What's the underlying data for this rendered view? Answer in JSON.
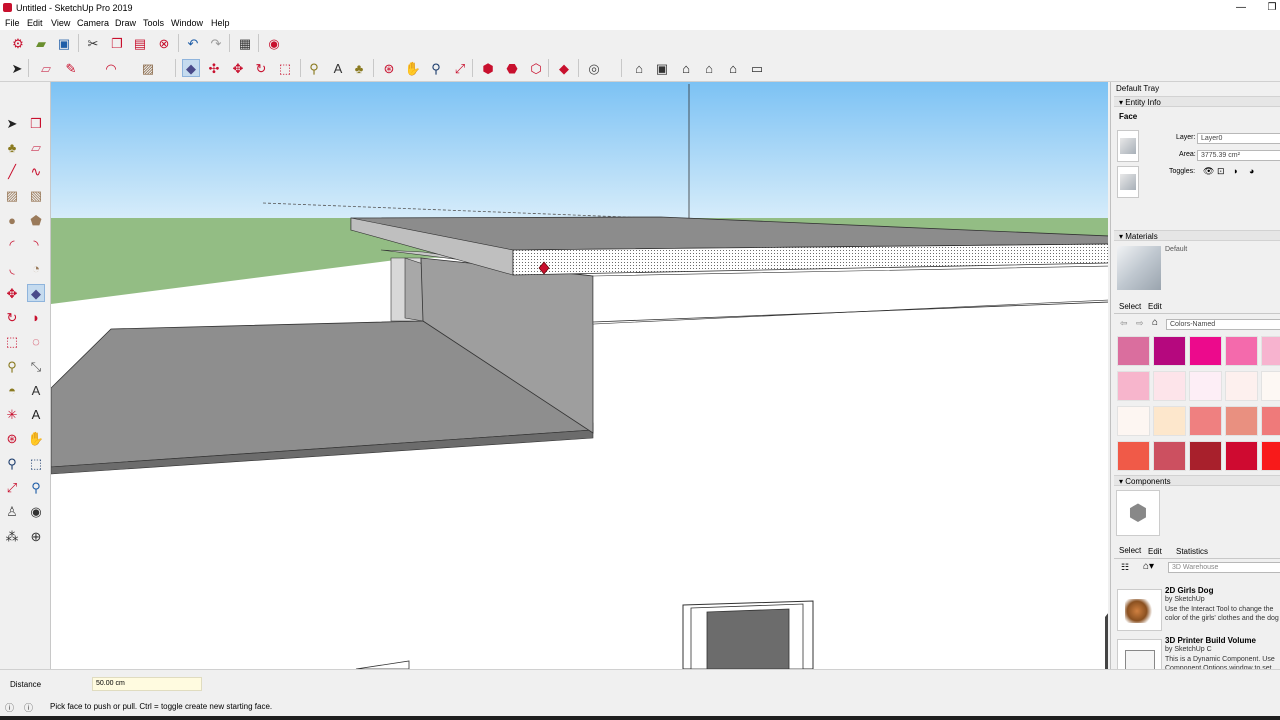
{
  "window": {
    "title": "Untitled - SketchUp Pro 2019",
    "minimize": "—",
    "restore": "❐"
  },
  "menu": [
    "File",
    "Edit",
    "View",
    "Camera",
    "Draw",
    "Tools",
    "Window",
    "Help"
  ],
  "toolbar1": [
    {
      "name": "getting-started-icon",
      "glyph": "⚙",
      "color": "#c8102e"
    },
    {
      "name": "open-icon",
      "glyph": "▰",
      "color": "#6a8f2f"
    },
    {
      "name": "save-icon",
      "glyph": "▣",
      "color": "#1f5ea8"
    },
    {
      "name": "cut-icon",
      "glyph": "✂",
      "color": "#333333"
    },
    {
      "name": "copy-icon",
      "glyph": "❐",
      "color": "#c8102e"
    },
    {
      "name": "paste-icon",
      "glyph": "▤",
      "color": "#c8102e"
    },
    {
      "name": "erase-icon",
      "glyph": "⊗",
      "color": "#c8102e"
    },
    {
      "name": "undo-icon",
      "glyph": "↶",
      "color": "#1f5ea8"
    },
    {
      "name": "redo-icon",
      "glyph": "↷",
      "color": "#9a9a9a"
    },
    {
      "name": "print-icon",
      "glyph": "▦",
      "color": "#333333"
    },
    {
      "name": "model-info-icon",
      "glyph": "◉",
      "color": "#c8102e"
    }
  ],
  "toolbar2": [
    {
      "name": "select-icon",
      "glyph": "➤",
      "color": "#222222"
    },
    {
      "name": "eraser-icon",
      "glyph": "▱",
      "color": "#d0506a"
    },
    {
      "name": "pencil-icon",
      "glyph": "✎",
      "color": "#c8102e"
    },
    {
      "name": "arc-icon",
      "glyph": "◠",
      "color": "#c8102e"
    },
    {
      "name": "rectangle-icon",
      "glyph": "▨",
      "color": "#8a6a4a"
    },
    {
      "name": "push-pull-icon",
      "glyph": "◆",
      "color": "#4a4a8a"
    },
    {
      "name": "move-icon",
      "glyph": "✣",
      "color": "#c8102e"
    },
    {
      "name": "move2-icon",
      "glyph": "✥",
      "color": "#c8102e"
    },
    {
      "name": "rotate-icon",
      "glyph": "↻",
      "color": "#c8102e"
    },
    {
      "name": "scale-icon",
      "glyph": "⬚",
      "color": "#c8102e"
    },
    {
      "name": "tape-measure-icon",
      "glyph": "⚲",
      "color": "#8a7a20"
    },
    {
      "name": "text-icon",
      "glyph": "A",
      "color": "#333333"
    },
    {
      "name": "paint-bucket-icon",
      "glyph": "♣",
      "color": "#8a7a20"
    },
    {
      "name": "orbit-icon",
      "glyph": "⊛",
      "color": "#c8102e"
    },
    {
      "name": "pan-icon",
      "glyph": "✋",
      "color": "#c8a030"
    },
    {
      "name": "zoom-icon",
      "glyph": "⚲",
      "color": "#1f3f6f"
    },
    {
      "name": "zoom-extents-icon",
      "glyph": "⤢",
      "color": "#c8102e"
    },
    {
      "name": "warehouse-icon",
      "glyph": "⬢",
      "color": "#c8102e"
    },
    {
      "name": "extension-warehouse-icon",
      "glyph": "⬣",
      "color": "#c8102e"
    },
    {
      "name": "share-model-icon",
      "glyph": "⬡",
      "color": "#c8102e"
    },
    {
      "name": "ruby-icon",
      "glyph": "◆",
      "color": "#c8102e"
    },
    {
      "name": "account-icon",
      "glyph": "◎",
      "color": "#444444"
    },
    {
      "name": "iso-view-icon",
      "glyph": "⌂",
      "color": "#333333"
    },
    {
      "name": "top-view-icon",
      "glyph": "▣",
      "color": "#333333"
    },
    {
      "name": "front-view-icon",
      "glyph": "⌂",
      "color": "#111111"
    },
    {
      "name": "right-view-icon",
      "glyph": "⌂",
      "color": "#333333"
    },
    {
      "name": "back-view-icon",
      "glyph": "⌂",
      "color": "#111111"
    },
    {
      "name": "left-view-icon",
      "glyph": "▭",
      "color": "#333333"
    }
  ],
  "lefttools": [
    {
      "name": "select-tool-icon",
      "glyph": "➤",
      "color": "#222222"
    },
    {
      "name": "make-component-icon",
      "glyph": "❒",
      "color": "#c8102e"
    },
    {
      "name": "paint-tool-icon",
      "glyph": "♣",
      "color": "#8a7a20"
    },
    {
      "name": "eraser-tool-icon",
      "glyph": "▱",
      "color": "#d0506a"
    },
    {
      "name": "line-tool-icon",
      "glyph": "╱",
      "color": "#c8102e"
    },
    {
      "name": "freehand-tool-icon",
      "glyph": "∿",
      "color": "#c8102e"
    },
    {
      "name": "rectangle-tool-icon",
      "glyph": "▨",
      "color": "#9a7a5a"
    },
    {
      "name": "rotated-rectangle-icon",
      "glyph": "▧",
      "color": "#9a7a5a"
    },
    {
      "name": "circle-tool-icon",
      "glyph": "●",
      "color": "#9a7a5a"
    },
    {
      "name": "polygon-tool-icon",
      "glyph": "⬟",
      "color": "#9a7a5a"
    },
    {
      "name": "arc-tool-icon",
      "glyph": "◜",
      "color": "#c8102e"
    },
    {
      "name": "two-point-arc-icon",
      "glyph": "◝",
      "color": "#c8102e"
    },
    {
      "name": "three-point-arc-icon",
      "glyph": "◟",
      "color": "#c8102e"
    },
    {
      "name": "pie-tool-icon",
      "glyph": "◔",
      "color": "#9a7a5a"
    },
    {
      "name": "move-tool-icon",
      "glyph": "✥",
      "color": "#c8102e"
    },
    {
      "name": "push-pull-tool-icon",
      "glyph": "◆",
      "color": "#4a4a8a"
    },
    {
      "name": "rotate-tool-icon",
      "glyph": "↻",
      "color": "#c8102e"
    },
    {
      "name": "follow-me-icon",
      "glyph": "◗",
      "color": "#c8102e"
    },
    {
      "name": "scale-tool-icon",
      "glyph": "⬚",
      "color": "#c8102e"
    },
    {
      "name": "offset-tool-icon",
      "glyph": "◌",
      "color": "#c8102e"
    },
    {
      "name": "tape-tool-icon",
      "glyph": "⚲",
      "color": "#8a7a20"
    },
    {
      "name": "dimension-tool-icon",
      "glyph": "⤡",
      "color": "#555555"
    },
    {
      "name": "protractor-icon",
      "glyph": "◓",
      "color": "#8a7a20"
    },
    {
      "name": "text-tool-icon",
      "glyph": "A",
      "color": "#333333"
    },
    {
      "name": "axes-tool-icon",
      "glyph": "✳",
      "color": "#c8102e"
    },
    {
      "name": "3d-text-icon",
      "glyph": "A",
      "color": "#222222"
    },
    {
      "name": "orbit-tool-icon",
      "glyph": "⊛",
      "color": "#c8102e"
    },
    {
      "name": "pan-tool-icon",
      "glyph": "✋",
      "color": "#c8a030"
    },
    {
      "name": "zoom-tool-icon",
      "glyph": "⚲",
      "color": "#1f3f6f"
    },
    {
      "name": "zoom-window-icon",
      "glyph": "⬚",
      "color": "#1f3f6f"
    },
    {
      "name": "zoom-extents-tool-icon",
      "glyph": "⤢",
      "color": "#c8102e"
    },
    {
      "name": "previous-view-icon",
      "glyph": "⚲",
      "color": "#1f5ea8"
    },
    {
      "name": "position-camera-icon",
      "glyph": "♙",
      "color": "#555555"
    },
    {
      "name": "look-around-icon",
      "glyph": "◉",
      "color": "#333333"
    },
    {
      "name": "walk-icon",
      "glyph": "⁂",
      "color": "#333333"
    },
    {
      "name": "section-plane-icon",
      "glyph": "⊕",
      "color": "#333333"
    }
  ],
  "tray": {
    "title": "Default Tray",
    "entity_info": {
      "header": "Entity Info",
      "type": "Face",
      "layer_label": "Layer:",
      "layer_value": "Layer0",
      "area_label": "Area:",
      "area_value": "3775.39 cm²",
      "toggles_label": "Toggles:"
    },
    "materials": {
      "header": "Materials",
      "current": "Default",
      "tab_select": "Select",
      "tab_edit": "Edit",
      "library": "Colors-Named",
      "swatches": [
        "#da6e9e",
        "#b5087e",
        "#ec0a8c",
        "#f46aac",
        "#f7b3cf",
        "#f7b5cc",
        "#fde4ea",
        "#fdeef6",
        "#fdf0ee",
        "#fdf8f4",
        "#fdf6f2",
        "#fde7cc",
        "#ef8080",
        "#e99080",
        "#ef7a7a",
        "#f05a48",
        "#cc5060",
        "#a8202c",
        "#cf0a30",
        "#f81a1a"
      ]
    },
    "components": {
      "header": "Components",
      "tab_select": "Select",
      "tab_edit": "Edit",
      "tab_statistics": "Statistics",
      "search_placeholder": "3D Warehouse",
      "items": [
        {
          "name": "2D Girls Dog",
          "by": "by SketchUp",
          "desc": "Use the Interact Tool to change the color of the girls' clothes and the dog"
        },
        {
          "name": "3D Printer Build Volume",
          "by": "by SketchUp C",
          "desc": "This is a Dynamic Component. Use Component Options window to set the"
        }
      ]
    }
  },
  "status": {
    "measurement_label": "Distance",
    "measurement_value": "50.00 cm",
    "hint": "Pick face to push or pull.  Ctrl = toggle create new starting face."
  }
}
